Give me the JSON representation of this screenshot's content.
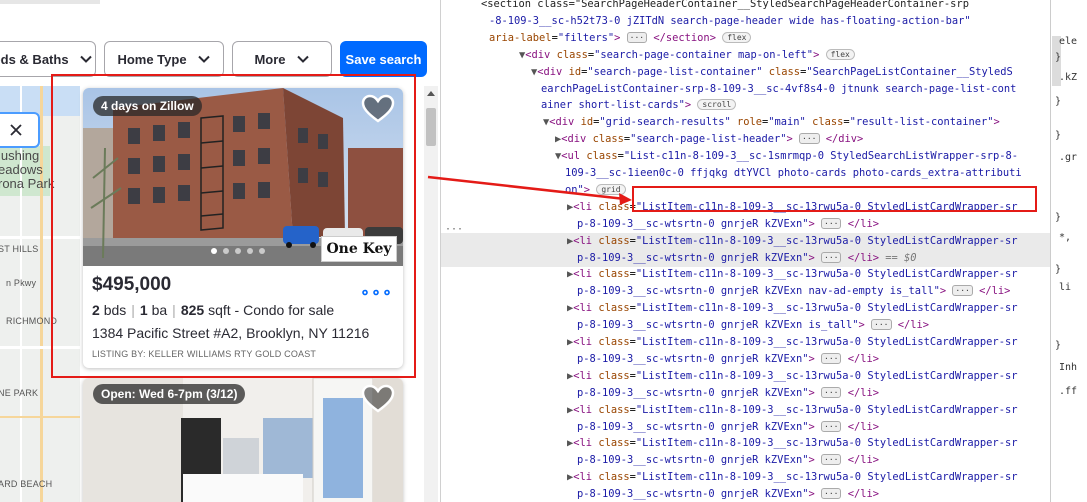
{
  "filters": {
    "beds_baths": "eds & Baths",
    "home_type": "Home Type",
    "more": "More",
    "save_search": "Save search"
  },
  "map": {
    "labels": [
      "lushing",
      "eadows",
      "rona Park",
      "ST HILLS",
      "n Pkwy",
      "RICHMOND",
      "NE PARK",
      "ARD BEACH"
    ]
  },
  "listing1": {
    "badge": "4 days on Zillow",
    "price": "$495,000",
    "beds": "2",
    "beds_unit": "bds",
    "baths": "1",
    "baths_unit": "ba",
    "sqft": "825",
    "sqft_unit": "sqft",
    "type": "- Condo for sale",
    "address": "1384 Pacific Street #A2, Brooklyn, NY 11216",
    "listing_by": "LISTING BY: KELLER WILLIAMS RTY GOLD COAST",
    "logo_text": "One Key",
    "more_icon": "ellipsis-icon"
  },
  "listing2": {
    "badge": "Open: Wed 6-7pm (3/12)"
  },
  "devtools": {
    "lines": [
      {
        "indent": 40,
        "html": "<span class=\"tx\">&lt;section class=\"SearchPageHeaderContainer__StyledSearchPageHeaderContainer-srp</span>"
      },
      {
        "indent": 48,
        "html": "<span class=\"av\">-8-109-3__sc-h52t73-0 jZITdN search-page-header wide has-floating-action-bar\"</span>"
      },
      {
        "indent": 48,
        "html": "<span class=\"at\">aria-label</span>=<span class=\"av\">\"filters\"</span><span class=\"tag\">&gt;</span> <span class=\"ell\">···</span> <span class=\"tag\">&lt;/section&gt;</span> <span class=\"pill\">flex</span>"
      },
      {
        "indent": 78,
        "tri": "▼",
        "html": "<span class=\"tag\">&lt;div</span> <span class=\"at\">class</span>=<span class=\"av\">\"search-page-container map-on-left\"</span><span class=\"tag\">&gt;</span> <span class=\"pill\">flex</span>"
      },
      {
        "indent": 90,
        "tri": "▼",
        "html": "<span class=\"tag\">&lt;div</span> <span class=\"at\">id</span>=<span class=\"av\">\"search-page-list-container\"</span> <span class=\"at\">class</span>=<span class=\"av\">\"SearchPageListContainer__StyledS</span>"
      },
      {
        "indent": 100,
        "html": "<span class=\"av\">earchPageListContainer-srp-8-109-3__sc-4vf8s4-0 jtnunk search-page-list-cont</span>"
      },
      {
        "indent": 100,
        "html": "<span class=\"av\">ainer short-list-cards\"</span><span class=\"tag\">&gt;</span> <span class=\"pill\">scroll</span>"
      },
      {
        "indent": 102,
        "tri": "▼",
        "html": "<span class=\"tag\">&lt;div</span> <span class=\"at\">id</span>=<span class=\"av\">\"grid-search-results\"</span> <span class=\"at\">role</span>=<span class=\"av\">\"main\"</span> <span class=\"at\">class</span>=<span class=\"av\">\"result-list-container\"</span><span class=\"tag\">&gt;</span>"
      },
      {
        "indent": 114,
        "tri": "▶",
        "html": "<span class=\"tag\">&lt;div</span> <span class=\"at\">class</span>=<span class=\"av\">\"search-page-list-header\"</span><span class=\"tag\">&gt;</span> <span class=\"ell\">···</span> <span class=\"tag\">&lt;/div&gt;</span>"
      },
      {
        "indent": 114,
        "tri": "▼",
        "html": "<span class=\"tag\">&lt;ul</span> <span class=\"at\">class</span>=<span class=\"av\">\"List-c11n-8-109-3__sc-1smrmqp-0 StyledSearchListWrapper-srp-8-</span>"
      },
      {
        "indent": 124,
        "html": "<span class=\"av\">109-3__sc-1ieen0c-0 ffjqkg dtYVCl photo-cards photo-cards_extra-attributi</span>"
      },
      {
        "indent": 124,
        "html": "<span class=\"av\">on\"</span><span class=\"tag\">&gt;</span> <span class=\"pill\">grid</span>"
      },
      {
        "indent": 126,
        "tri": "▶",
        "html": "<span class=\"tag\">&lt;li</span> <span class=\"at\">class</span>=<span class=\"av\">\"ListItem-c11n-8-109-3__sc-13rwu5a-0 StyledListCardWrapper-sr</span>"
      },
      {
        "indent": 136,
        "html": "<span class=\"av\">p-8-109-3__sc-wtsrtn-0 gnrjeR kZVExn\"</span><span class=\"tag\">&gt;</span> <span class=\"ell\">···</span> <span class=\"tag\">&lt;/li&gt;</span>"
      },
      {
        "indent": 126,
        "tri": "▶",
        "sel": true,
        "html": "<span class=\"tag\">&lt;li</span> <span class=\"at\">class</span>=<span class=\"av\">\"ListItem-c11n-8-109-3__sc-13rwu5a-0 StyledListCardWrapper-sr</span>"
      },
      {
        "indent": 136,
        "sel": true,
        "html": "<span class=\"av\">p-8-109-3__sc-wtsrtn-0 gnrjeR kZVExn\"</span><span class=\"tag\">&gt;</span> <span class=\"ell\">···</span> <span class=\"tag\">&lt;/li&gt;</span> <span class=\"eq\">== $0</span>"
      },
      {
        "indent": 126,
        "tri": "▶",
        "html": "<span class=\"tag\">&lt;li</span> <span class=\"at\">class</span>=<span class=\"av\">\"ListItem-c11n-8-109-3__sc-13rwu5a-0 StyledListCardWrapper-sr</span>"
      },
      {
        "indent": 136,
        "html": "<span class=\"av\">p-8-109-3__sc-wtsrtn-0 gnrjeR kZVExn nav-ad-empty is_tall\"</span><span class=\"tag\">&gt;</span> <span class=\"ell\">···</span> <span class=\"tag\">&lt;/li&gt;</span>"
      },
      {
        "indent": 126,
        "tri": "▶",
        "html": "<span class=\"tag\">&lt;li</span> <span class=\"at\">class</span>=<span class=\"av\">\"ListItem-c11n-8-109-3__sc-13rwu5a-0 StyledListCardWrapper-sr</span>"
      },
      {
        "indent": 136,
        "html": "<span class=\"av\">p-8-109-3__sc-wtsrtn-0 gnrjeR kZVExn is_tall\"</span><span class=\"tag\">&gt;</span> <span class=\"ell\">···</span> <span class=\"tag\">&lt;/li&gt;</span>"
      },
      {
        "indent": 126,
        "tri": "▶",
        "html": "<span class=\"tag\">&lt;li</span> <span class=\"at\">class</span>=<span class=\"av\">\"ListItem-c11n-8-109-3__sc-13rwu5a-0 StyledListCardWrapper-sr</span>"
      },
      {
        "indent": 136,
        "html": "<span class=\"av\">p-8-109-3__sc-wtsrtn-0 gnrjeR kZVExn\"</span><span class=\"tag\">&gt;</span> <span class=\"ell\">···</span> <span class=\"tag\">&lt;/li&gt;</span>"
      },
      {
        "indent": 126,
        "tri": "▶",
        "html": "<span class=\"tag\">&lt;li</span> <span class=\"at\">class</span>=<span class=\"av\">\"ListItem-c11n-8-109-3__sc-13rwu5a-0 StyledListCardWrapper-sr</span>"
      },
      {
        "indent": 136,
        "html": "<span class=\"av\">p-8-109-3__sc-wtsrtn-0 gnrjeR kZVExn\"</span><span class=\"tag\">&gt;</span> <span class=\"ell\">···</span> <span class=\"tag\">&lt;/li&gt;</span>"
      },
      {
        "indent": 126,
        "tri": "▶",
        "html": "<span class=\"tag\">&lt;li</span> <span class=\"at\">class</span>=<span class=\"av\">\"ListItem-c11n-8-109-3__sc-13rwu5a-0 StyledListCardWrapper-sr</span>"
      },
      {
        "indent": 136,
        "html": "<span class=\"av\">p-8-109-3__sc-wtsrtn-0 gnrjeR kZVExn\"</span><span class=\"tag\">&gt;</span> <span class=\"ell\">···</span> <span class=\"tag\">&lt;/li&gt;</span>"
      },
      {
        "indent": 126,
        "tri": "▶",
        "html": "<span class=\"tag\">&lt;li</span> <span class=\"at\">class</span>=<span class=\"av\">\"ListItem-c11n-8-109-3__sc-13rwu5a-0 StyledListCardWrapper-sr</span>"
      },
      {
        "indent": 136,
        "html": "<span class=\"av\">p-8-109-3__sc-wtsrtn-0 gnrjeR kZVExn\"</span><span class=\"tag\">&gt;</span> <span class=\"ell\">···</span> <span class=\"tag\">&lt;/li&gt;</span>"
      },
      {
        "indent": 126,
        "tri": "▶",
        "html": "<span class=\"tag\">&lt;li</span> <span class=\"at\">class</span>=<span class=\"av\">\"ListItem-c11n-8-109-3__sc-13rwu5a-0 StyledListCardWrapper-sr</span>"
      },
      {
        "indent": 136,
        "html": "<span class=\"av\">p-8-109-3__sc-wtsrtn-0 gnrjeR kZVExn\"</span><span class=\"tag\">&gt;</span> <span class=\"ell\">···</span> <span class=\"tag\">&lt;/li&gt;</span>"
      },
      {
        "indent": 126,
        "tri": "▶",
        "html": "<span class=\"tag\">&lt;li</span> <span class=\"at\">class</span>=<span class=\"av\">\"ListItem-c11n-8-109-3__sc-13rwu5a-0 StyledListCardWrapper-sr</span>"
      }
    ],
    "gutter_dots": "···"
  },
  "styles_pane": {
    "lines": [
      "ele",
      "}",
      ".kZ",
      "}",
      "}",
      ".gr",
      "}",
      "*,",
      "}",
      "li",
      "}",
      "Inh",
      ".ff"
    ]
  },
  "colors": {
    "accent": "#006aff",
    "highlight": "#e41b17"
  }
}
